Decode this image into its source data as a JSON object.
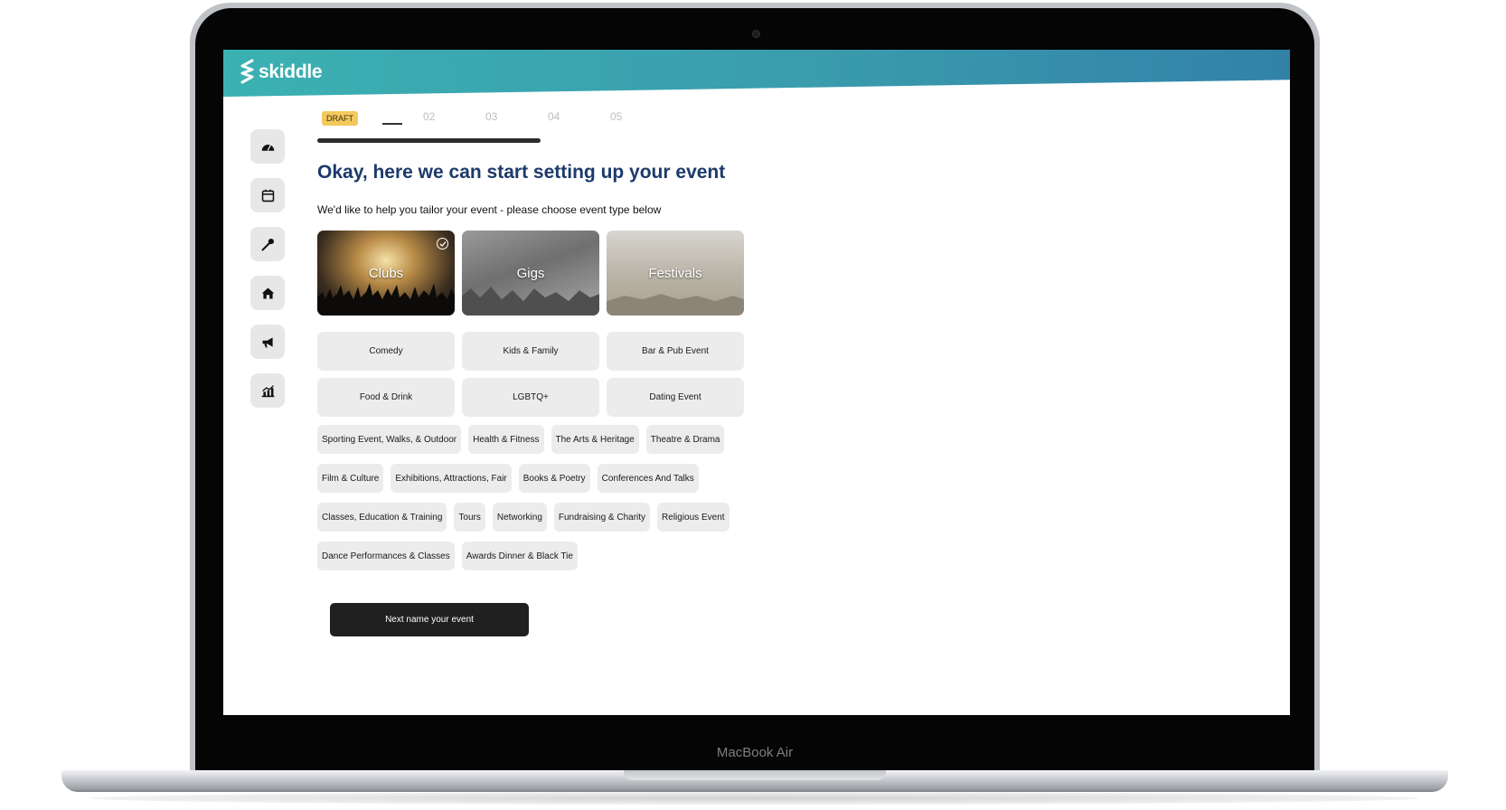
{
  "device": {
    "label": "MacBook Air"
  },
  "app": {
    "brand": "skiddle"
  },
  "sidebar": {
    "items": [
      {
        "name": "dashboard",
        "icon": "speedometer-icon"
      },
      {
        "name": "events",
        "icon": "calendar-icon"
      },
      {
        "name": "artists",
        "icon": "microphone-icon"
      },
      {
        "name": "venues",
        "icon": "home-icon"
      },
      {
        "name": "promotion",
        "icon": "megaphone-icon"
      },
      {
        "name": "reports",
        "icon": "chart-icon"
      }
    ]
  },
  "stepper": {
    "badge": "DRAFT",
    "steps": [
      "02",
      "03",
      "04",
      "05"
    ]
  },
  "main": {
    "title": "Okay, here we can start setting up your event",
    "subtitle": "We'd like to help you tailor your event - please choose event type below",
    "featured": [
      {
        "label": "Clubs",
        "selected": true
      },
      {
        "label": "Gigs",
        "selected": false
      },
      {
        "label": "Festivals",
        "selected": false
      }
    ],
    "wide": [
      "Comedy",
      "Kids & Family",
      "Bar & Pub Event",
      "Food & Drink",
      "LGBTQ+",
      "Dating Event"
    ],
    "chip_rows": [
      [
        "Sporting Event, Walks, & Outdoor",
        "Health & Fitness",
        "The Arts & Heritage",
        "Theatre & Drama"
      ],
      [
        "Film & Culture",
        "Exhibitions, Attractions, Fair",
        "Books & Poetry",
        "Conferences And Talks"
      ],
      [
        "Classes, Education & Training",
        "Tours",
        "Networking",
        "Fundraising & Charity",
        "Religious Event"
      ],
      [
        "Dance Performances & Classes",
        "Awards Dinner & Black Tie"
      ]
    ],
    "next_label": "Next name your event"
  },
  "colors": {
    "header_start": "#3bb1b2",
    "header_end": "#3282a8",
    "title": "#1c3a6b",
    "draft": "#f3c85d",
    "button": "#202020"
  }
}
